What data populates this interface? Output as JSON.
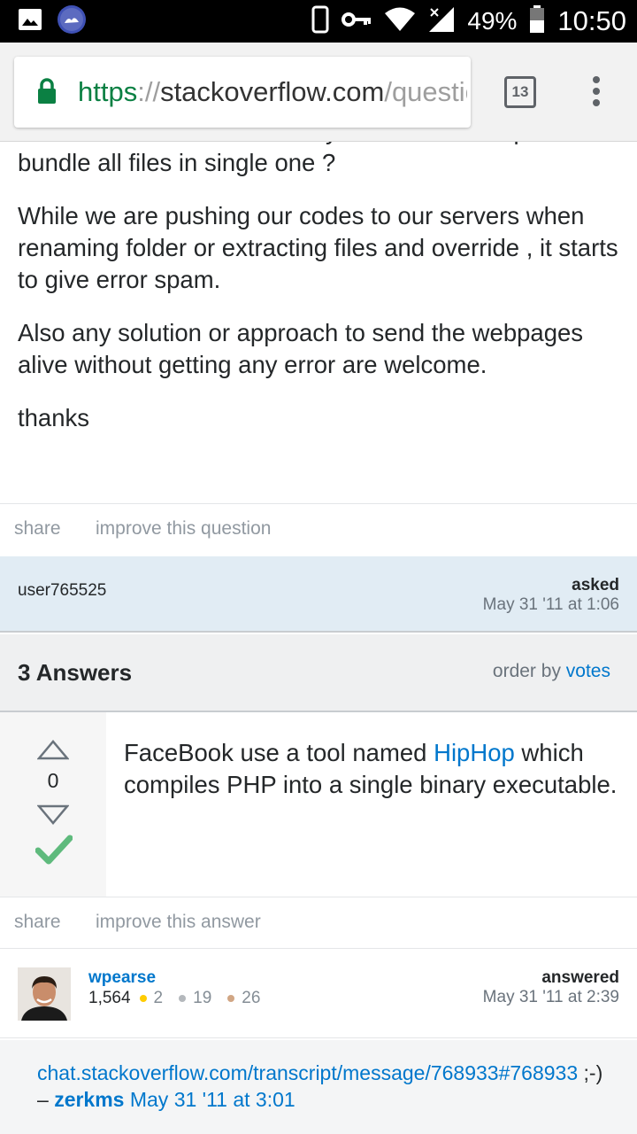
{
  "status_bar": {
    "battery": "49%",
    "time": "10:50",
    "icons": [
      "image-icon",
      "app-notification-icon",
      "phone-icon",
      "vpn-key-icon",
      "wifi-icon",
      "cell-signal-icon",
      "battery-icon"
    ]
  },
  "browser": {
    "url_scheme": "https",
    "url_sep": "://",
    "url_host": "stackoverflow.com",
    "url_rest": "/questions",
    "tab_count": "13"
  },
  "question": {
    "paragraphs": [
      "coded with PHP . Is there any encoder or compiler can bundle all files in single one ?",
      "While we are pushing our codes to our servers when renaming folder or extracting files and override , it starts to give error spam.",
      "Also any solution or approach to send the webpages alive without getting any error are welcome.",
      "thanks"
    ],
    "share_label": "share",
    "improve_label": "improve this question",
    "owner": "user765525",
    "asked_label": "asked",
    "asked_date": "May 31 '11 at 1:06"
  },
  "answers_header": {
    "count_label": "3 Answers",
    "order_by_label": "order by",
    "order_by_value": "votes"
  },
  "answer": {
    "votes": "0",
    "text_before": "FaceBook use a tool named ",
    "link_text": "HipHop",
    "text_after": " which compiles PHP into a single binary executable.",
    "share_label": "share",
    "improve_label": "improve this answer",
    "author": "wpearse",
    "reputation": "1,564",
    "gold": "2",
    "silver": "19",
    "bronze": "26",
    "answered_label": "answered",
    "answered_date": "May 31 '11 at 2:39"
  },
  "comment": {
    "link": "chat.stackoverflow.com/transcript/message/768933#768933",
    "text": " ;-) – ",
    "user": "zerkms",
    "date": "May 31 '11 at 3:01"
  },
  "colors": {
    "link": "#0077cc",
    "accepted": "#5fba7d",
    "owner_bg": "#e1ecf4",
    "gold": "#ffcc01",
    "silver": "#b4b8bc",
    "bronze": "#d1a684"
  }
}
